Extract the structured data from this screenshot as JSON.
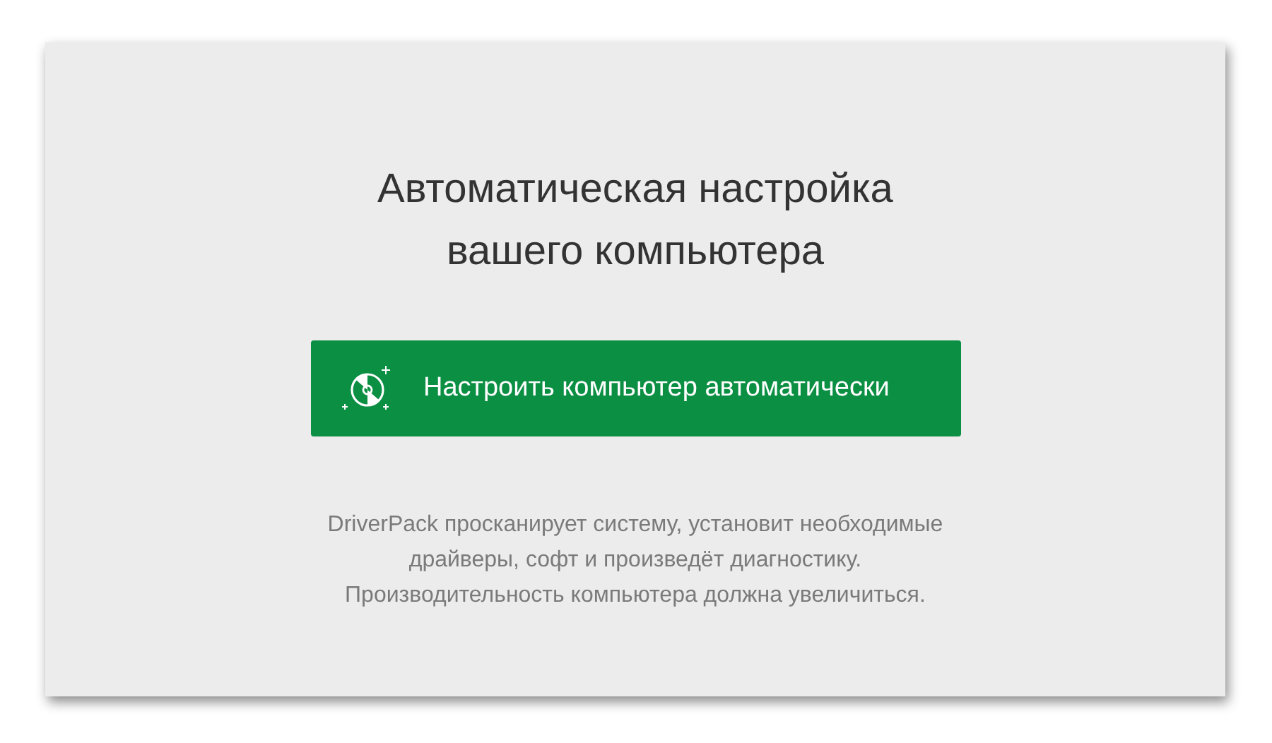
{
  "heading": "Автоматическая настройка\nвашего компьютера",
  "button": {
    "label": "Настроить компьютер автоматически"
  },
  "description": "DriverPack просканирует систему, установит необходимые\nдрайверы, софт и произведёт диагностику.\nПроизводительность компьютера должна увеличиться."
}
